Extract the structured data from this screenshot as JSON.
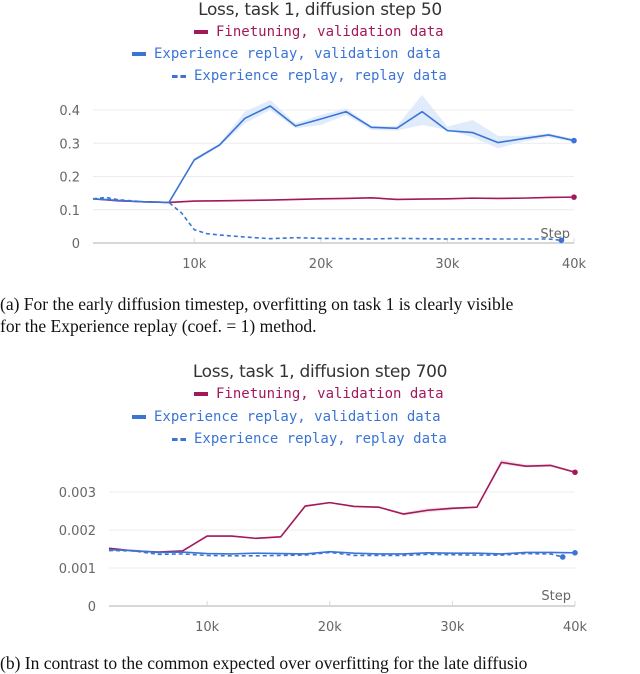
{
  "colors": {
    "finetuning": "#a3185a",
    "er": "#3b74d6",
    "er_band": "#dbe7fa",
    "ft_band": "#f3dce8",
    "grid": "#ececec",
    "axis": "#d7d7d7",
    "tick_text": "#666666"
  },
  "chart_data": [
    {
      "type": "line",
      "title": "Loss, task 1, diffusion step 50",
      "xlabel": "Step",
      "ylabel": "",
      "xlim": [
        2000,
        40000
      ],
      "ylim": [
        0,
        0.42
      ],
      "x_ticks": [
        10000,
        20000,
        30000,
        40000
      ],
      "x_tick_labels": [
        "10k",
        "20k",
        "30k",
        "40k"
      ],
      "y_ticks": [
        0,
        0.1,
        0.2,
        0.3,
        0.4
      ],
      "y_tick_labels": [
        "0",
        "0.1",
        "0.2",
        "0.3",
        "0.4"
      ],
      "grid": true,
      "legend": [
        "Finetuning, validation data",
        "Experience replay, validation data",
        "Experience replay, replay data"
      ],
      "legend_position": "top-center",
      "series": [
        {
          "name": "Finetuning, validation data",
          "style": "solid",
          "color_key": "finetuning",
          "x": [
            2000,
            4000,
            6000,
            8000,
            10000,
            12000,
            14000,
            16000,
            18000,
            20000,
            22000,
            24000,
            26000,
            28000,
            30000,
            32000,
            34000,
            36000,
            38000,
            40000
          ],
          "y": [
            0.133,
            0.127,
            0.124,
            0.122,
            0.126,
            0.127,
            0.128,
            0.129,
            0.131,
            0.133,
            0.134,
            0.136,
            0.131,
            0.132,
            0.133,
            0.135,
            0.134,
            0.135,
            0.137,
            0.138
          ]
        },
        {
          "name": "Experience replay, validation data",
          "style": "solid",
          "color_key": "er",
          "x": [
            2000,
            4000,
            6000,
            8000,
            10000,
            12000,
            14000,
            16000,
            18000,
            20000,
            22000,
            24000,
            26000,
            28000,
            30000,
            32000,
            34000,
            36000,
            38000,
            40000
          ],
          "y": [
            0.133,
            0.128,
            0.124,
            0.122,
            0.25,
            0.295,
            0.375,
            0.412,
            0.352,
            0.373,
            0.395,
            0.348,
            0.345,
            0.395,
            0.338,
            0.332,
            0.302,
            0.314,
            0.325,
            0.308
          ],
          "band_low": [
            0.131,
            0.126,
            0.122,
            0.12,
            0.245,
            0.29,
            0.36,
            0.4,
            0.345,
            0.355,
            0.385,
            0.34,
            0.338,
            0.355,
            0.34,
            0.318,
            0.285,
            0.305,
            0.318,
            0.303
          ],
          "band_high": [
            0.135,
            0.13,
            0.126,
            0.124,
            0.255,
            0.3,
            0.395,
            0.43,
            0.36,
            0.385,
            0.405,
            0.352,
            0.352,
            0.445,
            0.35,
            0.37,
            0.322,
            0.322,
            0.33,
            0.313
          ]
        },
        {
          "name": "Experience replay, replay data",
          "style": "dashed",
          "color_key": "er",
          "x": [
            2000,
            3000,
            4000,
            6000,
            8000,
            9000,
            10000,
            11000,
            12000,
            14000,
            16000,
            18000,
            20000,
            22000,
            24000,
            26000,
            28000,
            30000,
            32000,
            34000,
            36000,
            38000,
            39000
          ],
          "y": [
            0.133,
            0.137,
            0.13,
            0.124,
            0.122,
            0.09,
            0.04,
            0.028,
            0.024,
            0.018,
            0.013,
            0.016,
            0.014,
            0.013,
            0.012,
            0.014,
            0.013,
            0.012,
            0.013,
            0.012,
            0.012,
            0.012,
            0.008
          ]
        }
      ]
    },
    {
      "type": "line",
      "title": "Loss, task 1, diffusion step 700",
      "xlabel": "Step",
      "ylabel": "",
      "xlim": [
        2000,
        40000
      ],
      "ylim": [
        0,
        0.0039
      ],
      "x_ticks": [
        10000,
        20000,
        30000,
        40000
      ],
      "x_tick_labels": [
        "10k",
        "20k",
        "30k",
        "40k"
      ],
      "y_ticks": [
        0,
        0.001,
        0.002,
        0.003
      ],
      "y_tick_labels": [
        "0",
        "0.001",
        "0.002",
        "0.003"
      ],
      "grid": true,
      "legend": [
        "Finetuning, validation data",
        "Experience replay, validation data",
        "Experience replay, replay data"
      ],
      "legend_position": "top-center",
      "series": [
        {
          "name": "Finetuning, validation data",
          "style": "solid",
          "color_key": "finetuning",
          "x": [
            2000,
            4000,
            6000,
            8000,
            10000,
            12000,
            14000,
            16000,
            18000,
            20000,
            22000,
            24000,
            26000,
            28000,
            30000,
            32000,
            34000,
            36000,
            38000,
            40000
          ],
          "y": [
            0.00152,
            0.00145,
            0.00142,
            0.00145,
            0.00184,
            0.00184,
            0.00178,
            0.00182,
            0.00263,
            0.00272,
            0.00262,
            0.0026,
            0.00242,
            0.00252,
            0.00257,
            0.0026,
            0.00378,
            0.00368,
            0.0037,
            0.00352
          ],
          "band_low": [
            0.0015,
            0.00143,
            0.0014,
            0.00143,
            0.00182,
            0.00182,
            0.00176,
            0.0018,
            0.0026,
            0.0027,
            0.0026,
            0.00258,
            0.00238,
            0.00246,
            0.00253,
            0.00258,
            0.00372,
            0.00364,
            0.00366,
            0.0035
          ],
          "band_high": [
            0.00154,
            0.00147,
            0.00144,
            0.00147,
            0.00186,
            0.00186,
            0.0018,
            0.00184,
            0.00266,
            0.00274,
            0.00264,
            0.00262,
            0.00246,
            0.00258,
            0.00261,
            0.00262,
            0.00386,
            0.00372,
            0.00374,
            0.00355
          ]
        },
        {
          "name": "Experience replay, validation data",
          "style": "solid",
          "color_key": "er",
          "x": [
            2000,
            4000,
            6000,
            8000,
            10000,
            12000,
            14000,
            16000,
            18000,
            20000,
            22000,
            24000,
            26000,
            28000,
            30000,
            32000,
            34000,
            36000,
            38000,
            40000
          ],
          "y": [
            0.00148,
            0.00146,
            0.00141,
            0.00142,
            0.00138,
            0.00137,
            0.00139,
            0.00138,
            0.00137,
            0.00143,
            0.00139,
            0.00137,
            0.00137,
            0.0014,
            0.00139,
            0.00139,
            0.00137,
            0.00141,
            0.00141,
            0.0014
          ]
        },
        {
          "name": "Experience replay, replay data",
          "style": "dashed",
          "color_key": "er",
          "x": [
            2000,
            4000,
            6000,
            8000,
            10000,
            12000,
            14000,
            16000,
            18000,
            20000,
            22000,
            24000,
            26000,
            28000,
            30000,
            32000,
            34000,
            36000,
            38000,
            39000
          ],
          "y": [
            0.00146,
            0.00145,
            0.00136,
            0.00137,
            0.00133,
            0.00132,
            0.00132,
            0.00133,
            0.00134,
            0.00141,
            0.00133,
            0.00133,
            0.00133,
            0.00136,
            0.00135,
            0.00134,
            0.00134,
            0.00138,
            0.00137,
            0.00129
          ]
        }
      ]
    }
  ],
  "captions": [
    {
      "line1": "(a)  For the early diffusion timestep, overfitting on task 1 is clearly visible",
      "line2": "for the Experience replay (coef. = 1) method."
    },
    {
      "line1": "(b)   In contrast to the common expected over overfitting for the late diffusio"
    }
  ]
}
